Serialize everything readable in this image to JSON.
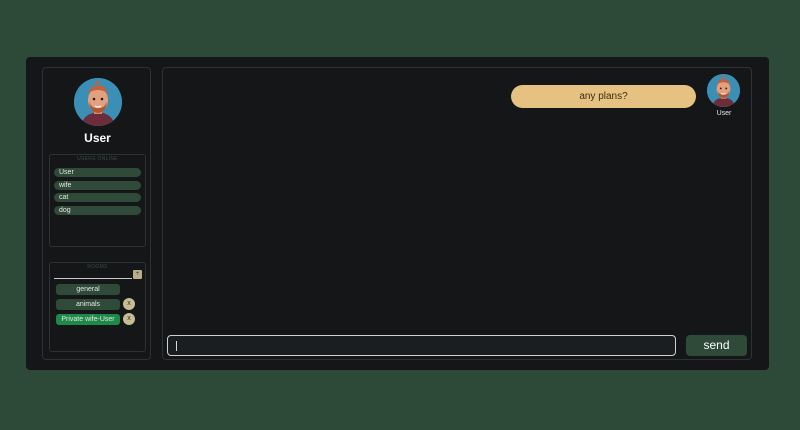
{
  "colors": {
    "page_bg": "#2d4a38",
    "panel_bg": "#141618",
    "accent_green": "#2f4a38",
    "private_green": "#1e8a4a",
    "bubble": "#e6c282"
  },
  "sidebar": {
    "user_name": "User",
    "avatar_icon": "user-avatar",
    "users_box": {
      "title": "USERS ONLINE",
      "items": [
        {
          "label": "User"
        },
        {
          "label": "wife"
        },
        {
          "label": "cat"
        },
        {
          "label": "dog"
        }
      ]
    },
    "rooms_box": {
      "title": "ROOMS",
      "input_value": "",
      "add_label": "+",
      "items": [
        {
          "label": "general",
          "closable": false
        },
        {
          "label": "animals",
          "closable": true
        },
        {
          "label": "Private wife-User",
          "closable": true,
          "private": true
        }
      ],
      "close_label": "x"
    }
  },
  "chat": {
    "messages": [
      {
        "text": "any plans?",
        "sender": "User"
      }
    ],
    "input_value": "",
    "send_label": "send"
  }
}
